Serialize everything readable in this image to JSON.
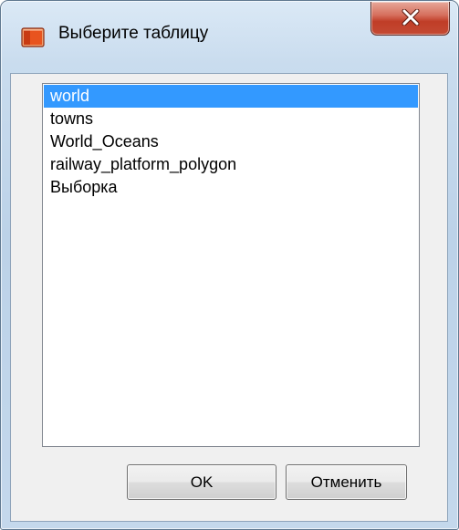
{
  "window": {
    "title": "Выберите таблицу",
    "icon": "table-icon",
    "close_icon": "close-icon"
  },
  "list": {
    "items": [
      "world",
      "towns",
      "World_Oceans",
      "railway_platform_polygon",
      "Выборка"
    ],
    "selected_index": 0
  },
  "buttons": {
    "ok_label": "OK",
    "cancel_label": "Отменить"
  },
  "colors": {
    "selection": "#3399ff",
    "close_button": "#c9432d",
    "icon_accent": "#e8541f"
  }
}
